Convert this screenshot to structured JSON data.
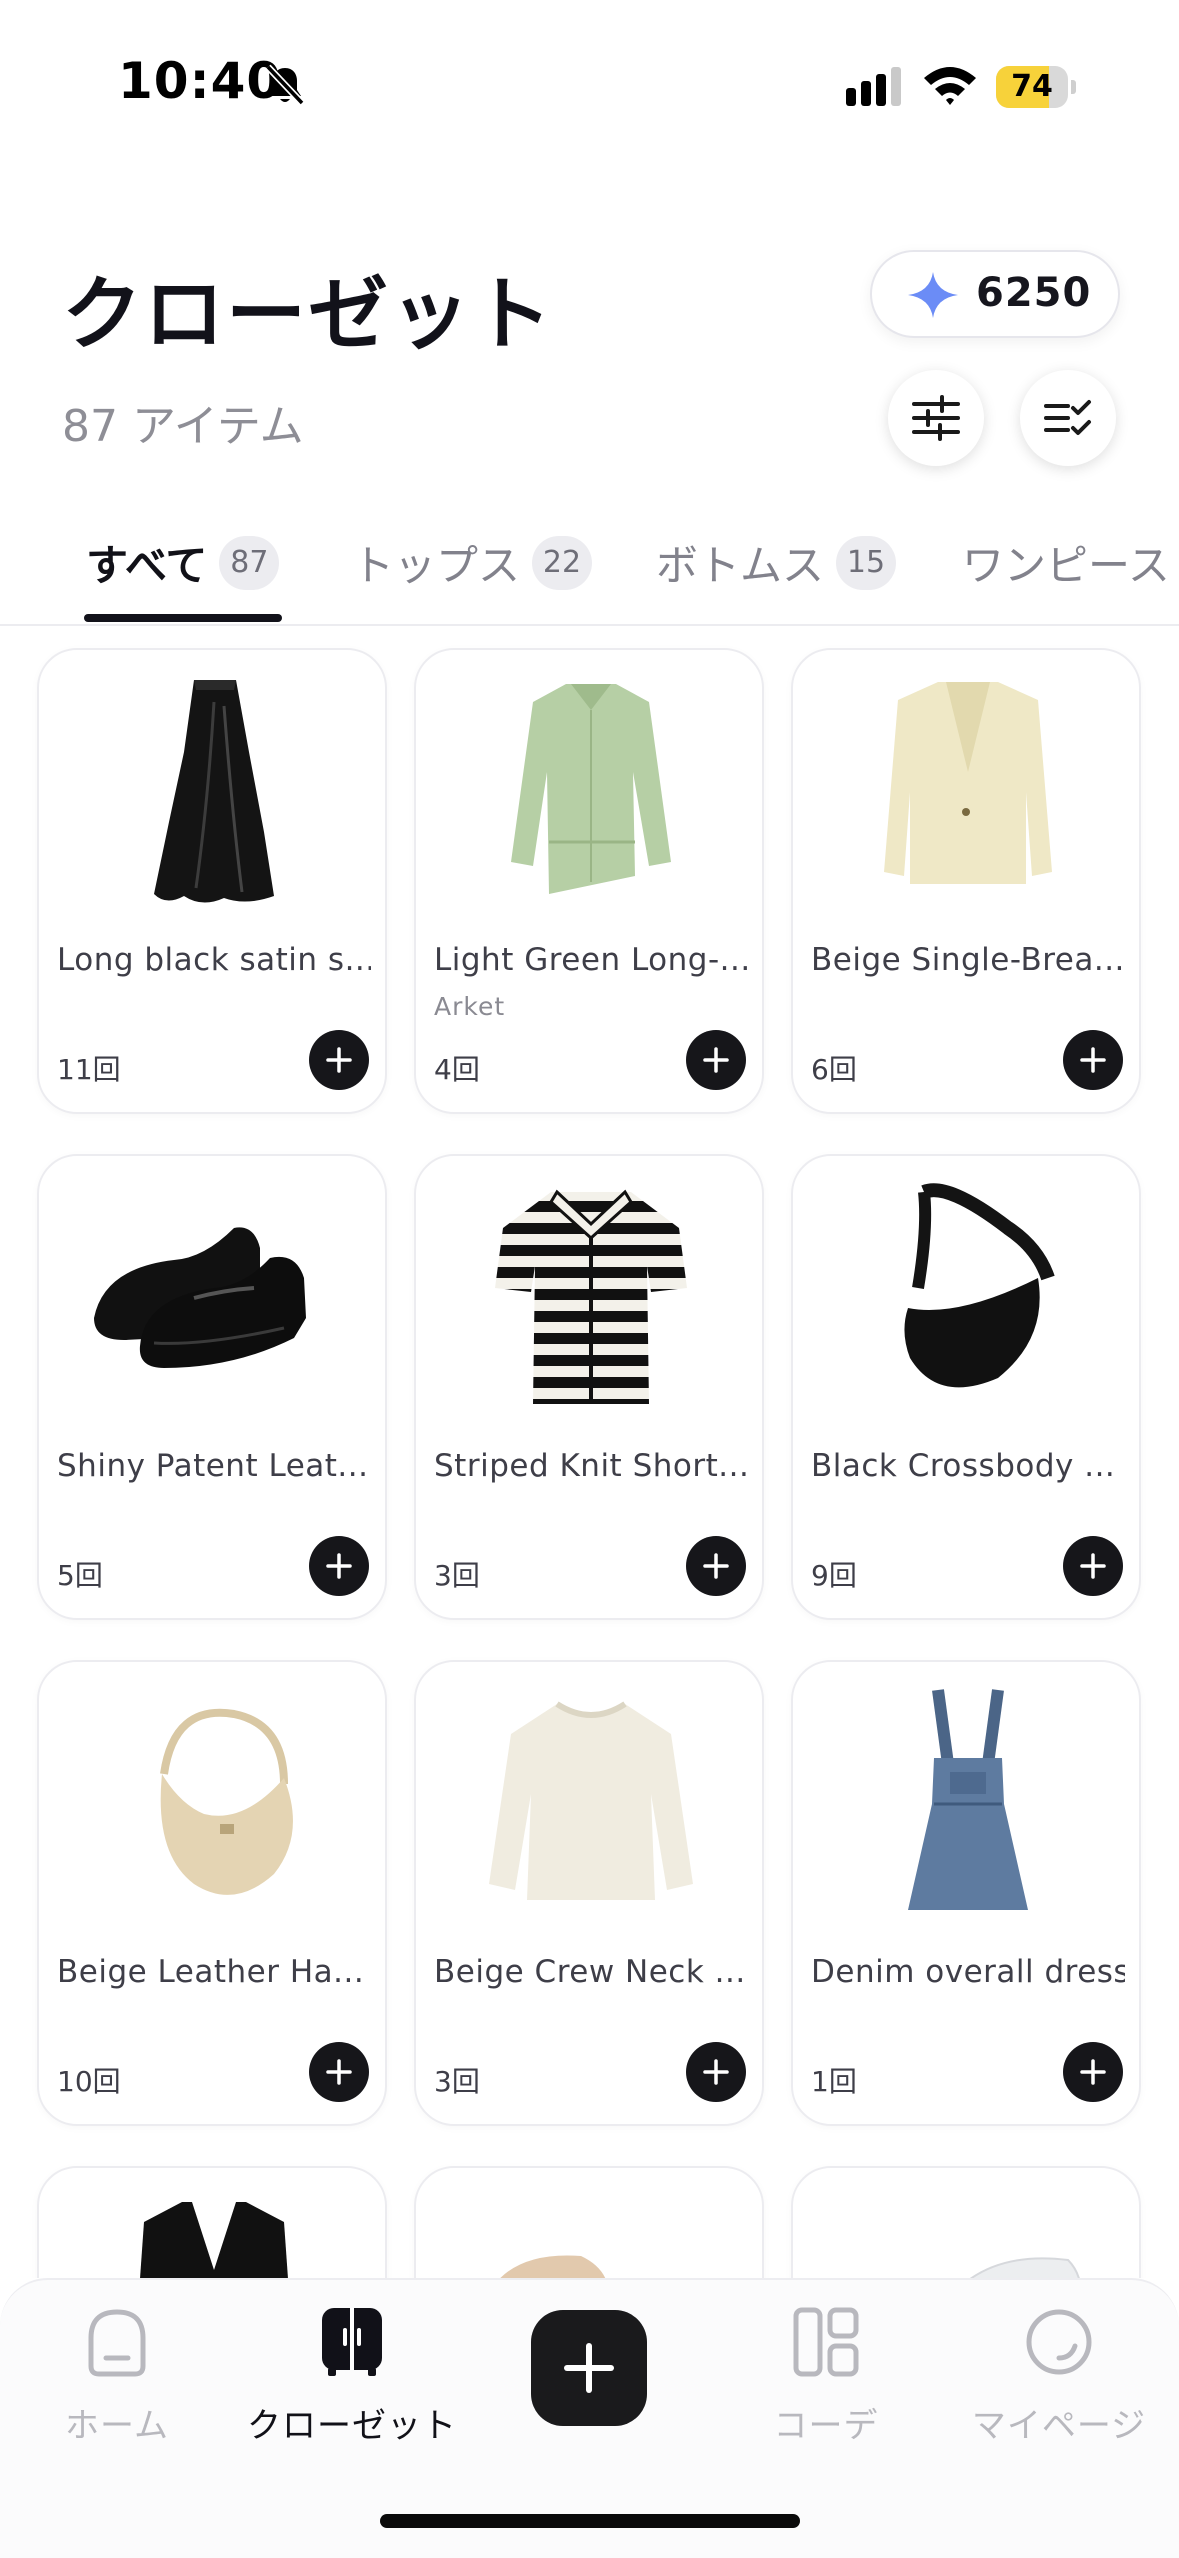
{
  "status_bar": {
    "time": "10:40",
    "battery": "74",
    "battery_level": 0.74,
    "bell_icon": "bell-slash-icon"
  },
  "header": {
    "title": "クローゼット",
    "item_count": "87 アイテム",
    "points": "6250",
    "points_icon": "sparkle-icon"
  },
  "tabs": [
    {
      "label": "すべて",
      "count": "87",
      "active": true
    },
    {
      "label": "トップス",
      "count": "22",
      "active": false
    },
    {
      "label": "ボトムス",
      "count": "15",
      "active": false
    },
    {
      "label": "ワンピース",
      "count": "",
      "active": false
    }
  ],
  "items": [
    {
      "name": "Long black satin s...",
      "brand": "",
      "wear": "11回"
    },
    {
      "name": "Light Green Long-...",
      "brand": "Arket",
      "wear": "4回"
    },
    {
      "name": "Beige Single-Brea...",
      "brand": "",
      "wear": "6回"
    },
    {
      "name": "Shiny Patent Leat...",
      "brand": "",
      "wear": "5回"
    },
    {
      "name": "Striped Knit Short...",
      "brand": "",
      "wear": "3回"
    },
    {
      "name": "Black Crossbody ...",
      "brand": "",
      "wear": "9回"
    },
    {
      "name": "Beige Leather Ha...",
      "brand": "",
      "wear": "10回"
    },
    {
      "name": "Beige Crew Neck ...",
      "brand": "",
      "wear": "3回"
    },
    {
      "name": "Denim overall dress",
      "brand": "",
      "wear": "1回"
    },
    {
      "name": "",
      "brand": "",
      "wear": ""
    },
    {
      "name": "",
      "brand": "",
      "wear": ""
    },
    {
      "name": "",
      "brand": "",
      "wear": ""
    }
  ],
  "bottom_nav": {
    "home": "ホーム",
    "closet": "クローゼット",
    "coordinate": "コーデ",
    "mypage": "マイページ",
    "active": "closet"
  },
  "colors": {
    "accent": "#6b8cf6",
    "dark": "#16161a",
    "muted": "#8e8e96"
  }
}
